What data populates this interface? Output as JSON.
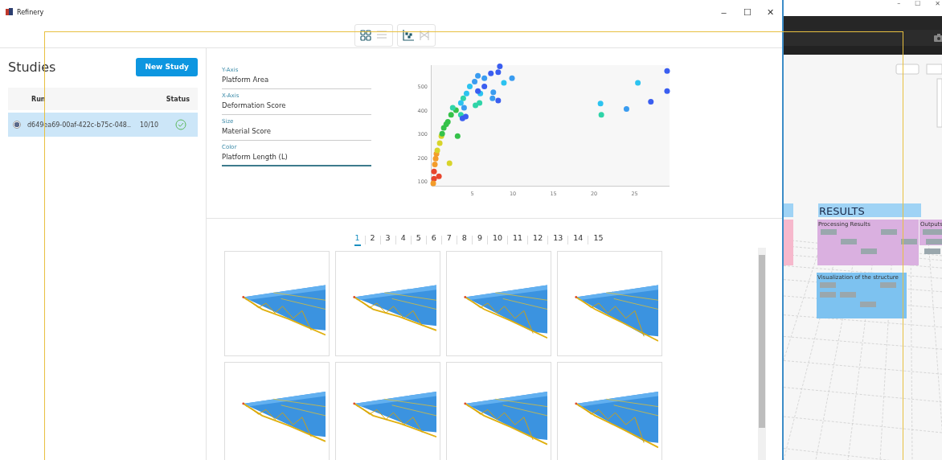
{
  "window": {
    "title": "Refinery",
    "controls": [
      "–",
      "☐",
      "✕"
    ]
  },
  "view_toggles": [
    {
      "kind": "grid",
      "selected": true
    },
    {
      "kind": "list",
      "selected": false
    },
    {
      "kind": "scatter",
      "selected": true
    },
    {
      "kind": "parallel",
      "selected": false
    }
  ],
  "studies": {
    "title": "Studies",
    "new_button": "New Study",
    "columns": [
      "Run",
      "Status"
    ],
    "rows": [
      {
        "run": "d649ea69-00af-422c-b75c-048..",
        "count": "10/10",
        "complete": true,
        "selected": true
      }
    ]
  },
  "axes": [
    {
      "label": "Y-Axis",
      "value": "Platform Area",
      "focused": false
    },
    {
      "label": "X-Axis",
      "value": "Deformation Score",
      "focused": false
    },
    {
      "label": "Size",
      "value": "Material Score",
      "focused": false
    },
    {
      "label": "Color",
      "value": "Platform Length (L)",
      "focused": true
    }
  ],
  "chart_data": {
    "type": "scatter",
    "xlim": [
      0,
      29.3
    ],
    "ylim": [
      80,
      590
    ],
    "xticks": [
      5,
      10,
      15,
      20,
      25
    ],
    "yticks": [
      100,
      200,
      300,
      400,
      500
    ],
    "x": [
      0.3,
      0.9,
      0.3,
      0.5,
      0.2,
      0.4,
      0.6,
      0.7,
      1,
      2.2,
      1.2,
      1.5,
      3,
      1.3,
      2,
      2.4,
      3.2,
      1.8,
      3.6,
      3.9,
      5.4,
      5.9,
      2.6,
      20.9,
      4.7,
      3.6,
      8.9,
      25.4,
      20.8,
      4.3,
      6,
      5.7,
      5.3,
      6.5,
      7.6,
      7.5,
      9.9,
      4,
      24,
      8.2,
      8.4,
      7.3,
      6.5,
      5.7,
      8.2,
      29,
      29,
      27,
      3.8,
      4.2
    ],
    "series": [
      {
        "color": "#e8452c",
        "values": [
          140,
          120,
          110,
          null,
          null,
          null,
          null,
          null,
          null,
          null,
          null,
          null,
          null,
          null,
          null,
          null,
          null,
          null,
          null,
          null,
          null,
          null,
          null,
          null,
          null,
          null,
          null,
          null,
          null,
          null,
          null,
          null,
          null,
          null,
          null,
          null,
          null,
          null,
          null,
          null,
          null,
          null,
          null,
          null,
          null,
          null,
          null,
          null,
          null,
          null
        ]
      },
      {
        "color": "#f39c2a",
        "values": [
          null,
          null,
          null,
          195,
          90,
          170,
          215,
          null,
          null,
          null,
          null,
          null,
          null,
          null,
          null,
          null,
          null,
          null,
          null,
          null,
          null,
          null,
          null,
          null,
          null,
          null,
          null,
          null,
          null,
          null,
          null,
          null,
          null,
          null,
          null,
          null,
          null,
          null,
          null,
          null,
          null,
          null,
          null,
          null,
          null,
          null,
          null,
          null,
          null,
          null
        ]
      },
      {
        "color": "#d8d42a",
        "values": [
          null,
          null,
          null,
          null,
          null,
          null,
          null,
          230,
          260,
          175,
          290,
          null,
          null,
          null,
          null,
          null,
          null,
          null,
          null,
          null,
          null,
          null,
          null,
          null,
          null,
          null,
          null,
          null,
          null,
          null,
          null,
          null,
          null,
          null,
          null,
          null,
          null,
          null,
          null,
          null,
          null,
          null,
          null,
          null,
          null,
          null,
          null,
          null,
          null,
          null
        ]
      },
      {
        "color": "#36c24a",
        "values": [
          null,
          null,
          null,
          null,
          null,
          null,
          null,
          null,
          null,
          null,
          null,
          325,
          400,
          300,
          350,
          380,
          290,
          340,
          null,
          null,
          null,
          null,
          null,
          null,
          null,
          null,
          null,
          null,
          null,
          null,
          null,
          null,
          null,
          null,
          null,
          null,
          null,
          null,
          null,
          null,
          null,
          null,
          null,
          null,
          null,
          null,
          null,
          null,
          null,
          null
        ]
      },
      {
        "color": "#2fd4a8",
        "values": [
          null,
          null,
          null,
          null,
          null,
          null,
          null,
          null,
          null,
          null,
          null,
          null,
          null,
          null,
          null,
          null,
          null,
          null,
          380,
          450,
          420,
          430,
          410,
          380,
          null,
          null,
          null,
          null,
          null,
          null,
          null,
          null,
          null,
          null,
          null,
          null,
          null,
          null,
          null,
          null,
          null,
          null,
          null,
          null,
          null,
          null,
          null,
          null,
          null,
          null
        ]
      },
      {
        "color": "#2cc3f0",
        "values": [
          null,
          null,
          null,
          null,
          null,
          null,
          null,
          null,
          null,
          null,
          null,
          null,
          null,
          null,
          null,
          null,
          null,
          null,
          null,
          null,
          null,
          null,
          null,
          null,
          500,
          430,
          515,
          515,
          428,
          470,
          470,
          null,
          null,
          null,
          null,
          null,
          null,
          null,
          null,
          null,
          null,
          null,
          null,
          null,
          null,
          null,
          null,
          null,
          null,
          null
        ]
      },
      {
        "color": "#3a9cf0",
        "values": [
          null,
          null,
          null,
          null,
          null,
          null,
          null,
          null,
          null,
          null,
          null,
          null,
          null,
          null,
          null,
          null,
          null,
          null,
          null,
          null,
          null,
          null,
          null,
          null,
          null,
          null,
          null,
          null,
          null,
          null,
          null,
          545,
          520,
          535,
          475,
          450,
          535,
          410,
          405,
          null,
          null,
          null,
          null,
          null,
          null,
          null,
          null,
          null,
          null,
          null
        ]
      },
      {
        "color": "#3a5ef0",
        "values": [
          null,
          null,
          null,
          null,
          null,
          null,
          null,
          null,
          null,
          null,
          null,
          null,
          null,
          null,
          null,
          null,
          null,
          null,
          null,
          null,
          null,
          null,
          null,
          null,
          null,
          null,
          null,
          null,
          null,
          null,
          null,
          null,
          null,
          null,
          null,
          null,
          null,
          null,
          null,
          560,
          585,
          555,
          500,
          480,
          440,
          565,
          480,
          435,
          365,
          372
        ]
      }
    ]
  },
  "pages": [
    {
      "label": "1",
      "selected": true
    },
    {
      "label": "2",
      "selected": false
    },
    {
      "label": "3",
      "selected": false
    },
    {
      "label": "4",
      "selected": false
    },
    {
      "label": "5",
      "selected": false
    },
    {
      "label": "6",
      "selected": false
    },
    {
      "label": "7",
      "selected": false
    },
    {
      "label": "8",
      "selected": false
    },
    {
      "label": "9",
      "selected": false
    },
    {
      "label": "10",
      "selected": false
    },
    {
      "label": "11",
      "selected": false
    },
    {
      "label": "12",
      "selected": false
    },
    {
      "label": "13",
      "selected": false
    },
    {
      "label": "14",
      "selected": false
    },
    {
      "label": "15",
      "selected": false
    }
  ],
  "background_app": {
    "controls": [
      "–",
      "☐",
      "✕"
    ],
    "groups": [
      {
        "title": "RESULTS",
        "kind": "header"
      },
      {
        "title": "Processing Results",
        "kind": "purple"
      },
      {
        "title": "Outputs",
        "kind": "purple-side"
      },
      {
        "title": "Visualization of the structure",
        "kind": "blue"
      }
    ]
  }
}
